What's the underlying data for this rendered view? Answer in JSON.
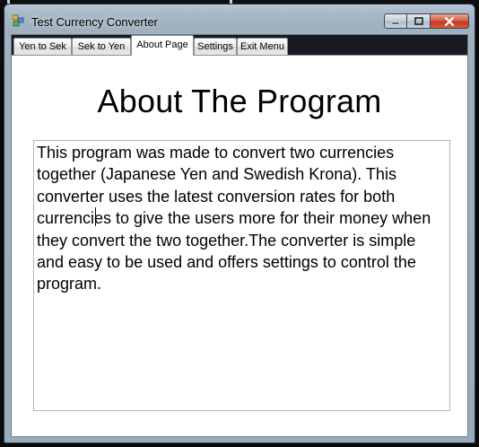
{
  "window": {
    "title": "Test Currency Converter",
    "icons": {
      "app": "app-form-icon",
      "minimize": "minimize-icon",
      "maximize": "maximize-icon",
      "close": "close-icon"
    },
    "colors": {
      "close_button": "#c4391f",
      "frame": "#9fb0c0"
    }
  },
  "tabs": [
    {
      "label": "Yen to Sek",
      "selected": false
    },
    {
      "label": "Sek to Yen",
      "selected": false
    },
    {
      "label": "About Page",
      "selected": true
    },
    {
      "label": "Settings",
      "selected": false
    },
    {
      "label": "Exit Menu",
      "selected": false
    }
  ],
  "about": {
    "heading": "About The Program",
    "body": "This program was made to convert two currencies together (Japanese Yen and Swedish Krona). This converter uses the latest conversion rates for both currencies to give the users more for their money when they convert the two together.The converter is simple and easy to be used and offers settings to control the program."
  }
}
